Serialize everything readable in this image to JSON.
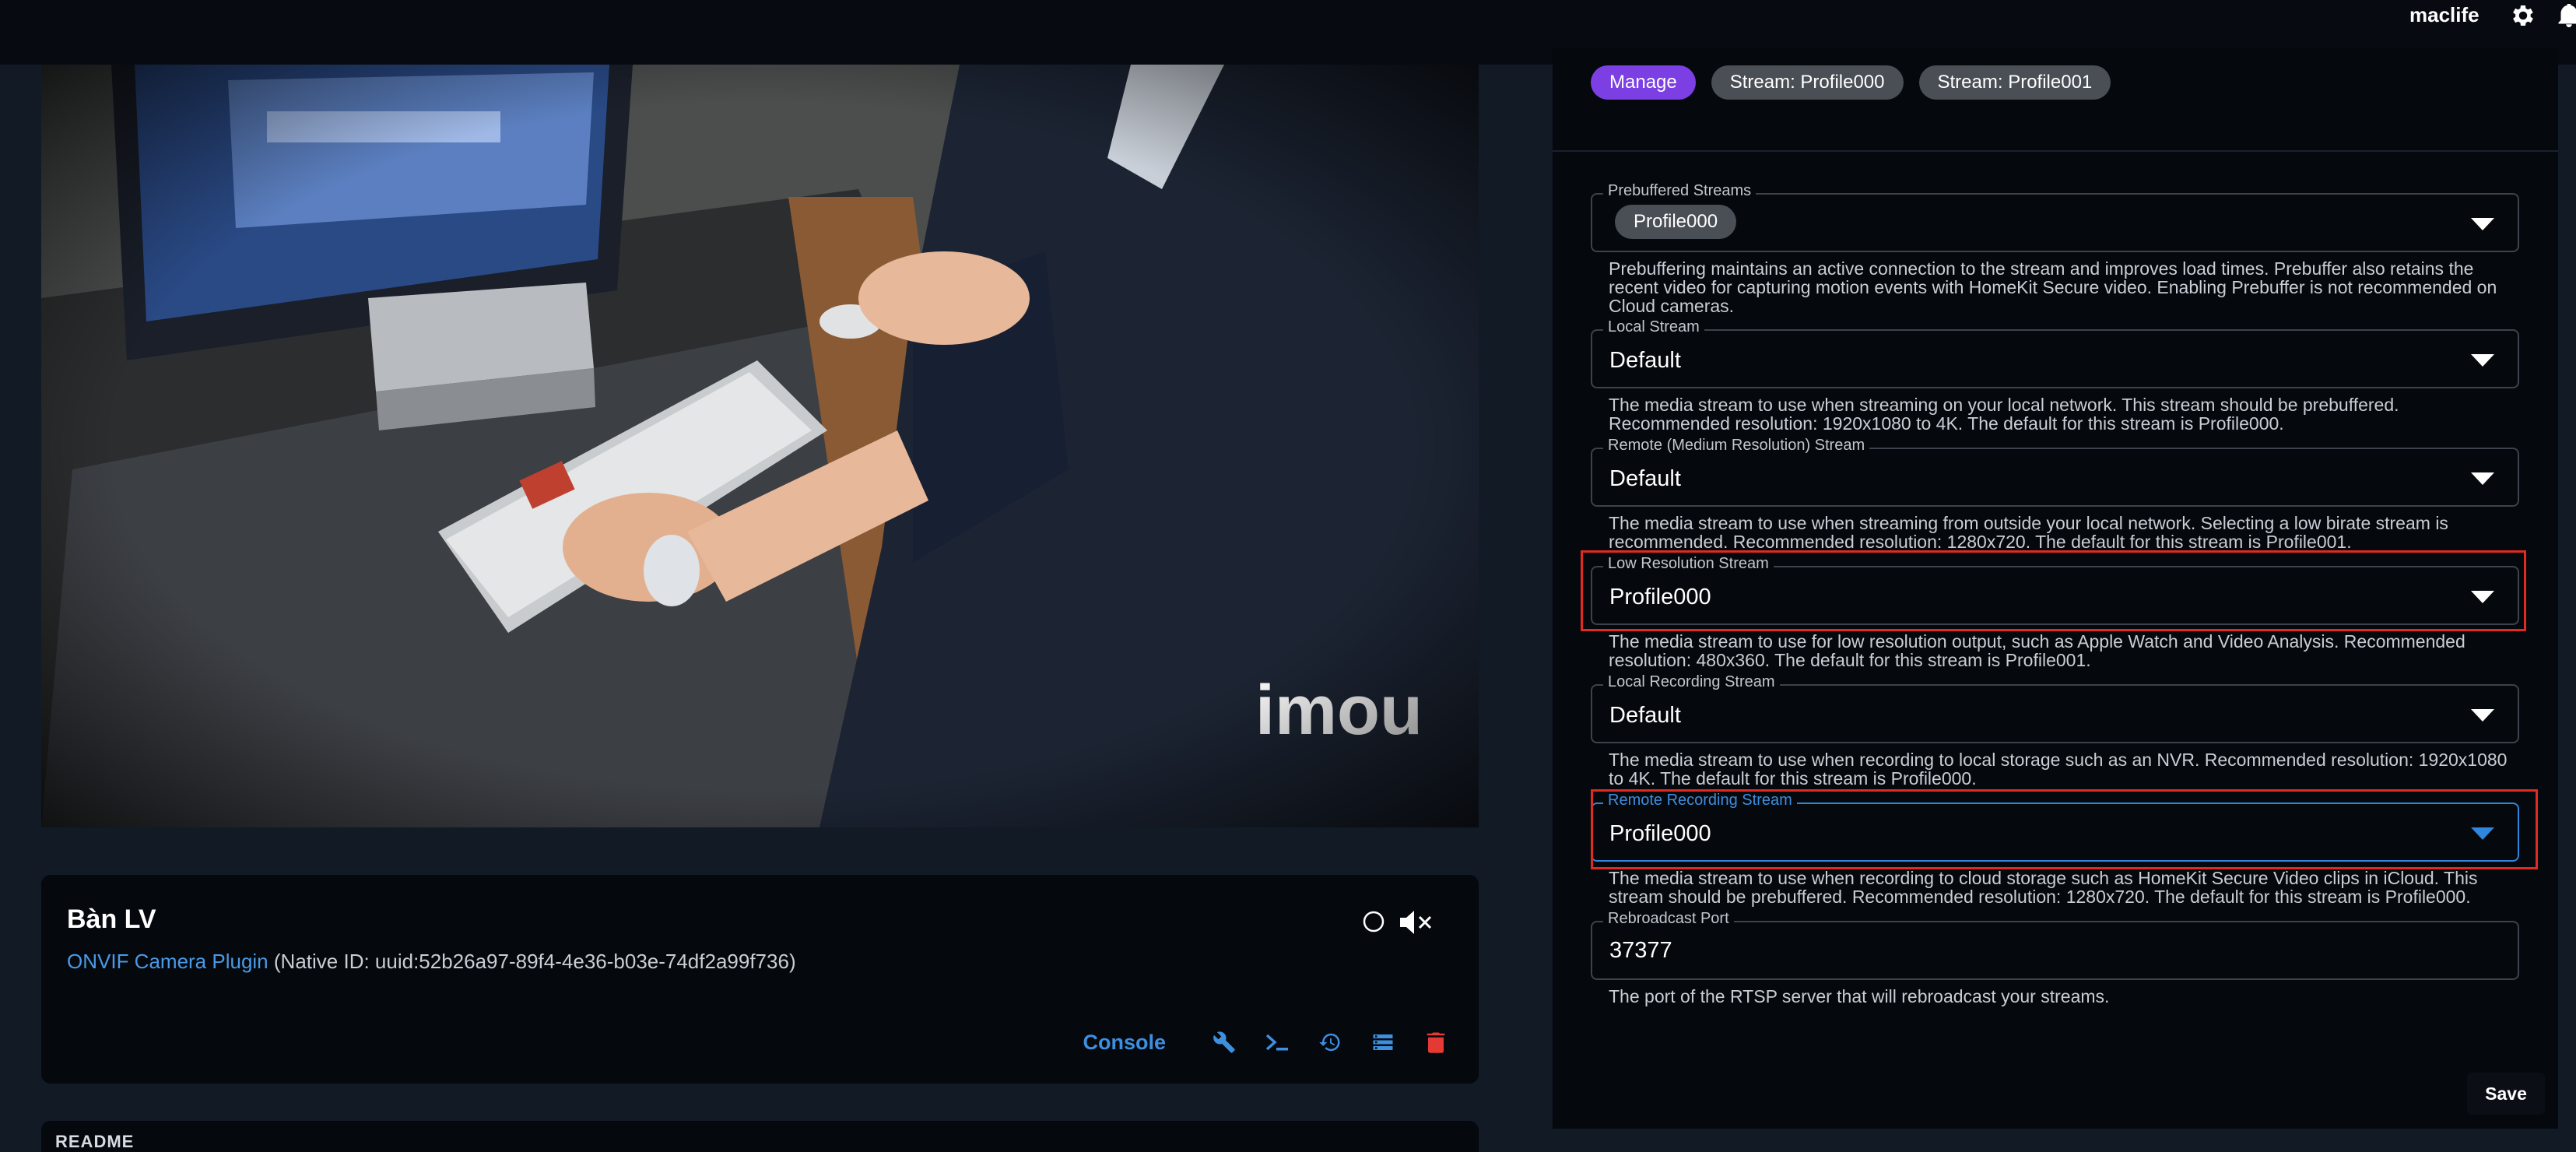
{
  "header": {
    "username": "maclife",
    "icons": [
      "gear-icon",
      "bell-icon"
    ]
  },
  "video": {
    "watermark": "imou"
  },
  "device": {
    "name": "Bàn LV",
    "plugin_link": "ONVIF Camera Plugin",
    "native_id": "(Native ID: uuid:52b26a97-89f4-4e36-b03e-74df2a99f736)",
    "console_label": "Console",
    "action_icons": [
      "wrench-icon",
      "terminal-icon",
      "history-icon",
      "storage-icon",
      "trash-icon"
    ]
  },
  "readme": {
    "label": "README"
  },
  "tabs": [
    {
      "label": "Manage",
      "active": true
    },
    {
      "label": "Stream: Profile000",
      "active": false
    },
    {
      "label": "Stream: Profile001",
      "active": false
    }
  ],
  "settings": {
    "prebuffered": {
      "label": "Prebuffered Streams",
      "chip": "Profile000",
      "help": "Prebuffering maintains an active connection to the stream and improves load times. Prebuffer also retains the recent video for capturing motion events with HomeKit Secure video. Enabling Prebuffer is not recommended on Cloud cameras."
    },
    "local_stream": {
      "label": "Local Stream",
      "value": "Default",
      "help": "The media stream to use when streaming on your local network. This stream should be prebuffered. Recommended resolution: 1920x1080 to 4K. The default for this stream is Profile000."
    },
    "remote_stream": {
      "label": "Remote (Medium Resolution) Stream",
      "value": "Default",
      "help": "The media stream to use when streaming from outside your local network. Selecting a low birate stream is recommended. Recommended resolution: 1280x720. The default for this stream is Profile001."
    },
    "low_res_stream": {
      "label": "Low Resolution Stream",
      "value": "Profile000",
      "help": "The media stream to use for low resolution output, such as Apple Watch and Video Analysis. Recommended resolution: 480x360. The default for this stream is Profile001."
    },
    "local_recording": {
      "label": "Local Recording Stream",
      "value": "Default",
      "help": "The media stream to use when recording to local storage such as an NVR. Recommended resolution: 1920x1080 to 4K. The default for this stream is Profile000."
    },
    "remote_recording": {
      "label": "Remote Recording Stream",
      "value": "Profile000",
      "help": "The media stream to use when recording to cloud storage such as HomeKit Secure Video clips in iCloud. This stream should be prebuffered. Recommended resolution: 1280x720. The default for this stream is Profile000."
    },
    "rebroadcast_port": {
      "label": "Rebroadcast Port",
      "value": "37377",
      "help": "The port of the RTSP server that will rebroadcast your streams."
    }
  },
  "save_label": "Save",
  "colors": {
    "accent": "#7b3fe4",
    "link": "#3d8fe0",
    "highlight": "#e02a22",
    "focus": "#2f86dc",
    "danger": "#e53935"
  }
}
